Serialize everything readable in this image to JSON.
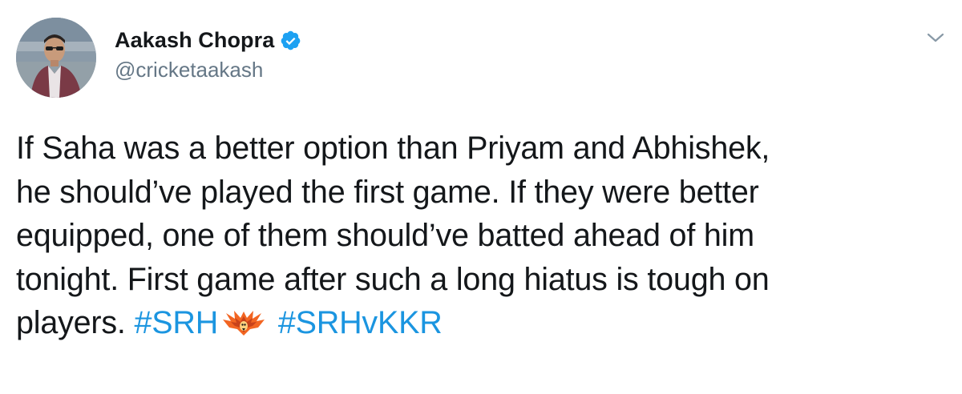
{
  "user": {
    "display_name": "Aakash Chopra",
    "handle": "@cricketaakash",
    "verified_icon": "verified-badge-icon",
    "avatar_icon": "profile-photo"
  },
  "menu": {
    "icon": "chevron-down-icon"
  },
  "tweet": {
    "lines": [
      "If Saha was a better option than Priyam and Abhishek,",
      "he should’ve played the first game. If they were better",
      "equipped, one of them should’ve batted ahead of him",
      "tonight. First game after such a long hiatus is tough on"
    ],
    "last_line_text": "players.",
    "hashtag_1": "#SRH",
    "hashtag_1_emoji": "srh-eagle-emoji-icon",
    "hashtag_2": "#SRHvKKR"
  },
  "colors": {
    "text": "#14171a",
    "secondary": "#657786",
    "link": "#1b95e0",
    "verified": "#1da1f2",
    "srh_orange": "#f26522"
  }
}
